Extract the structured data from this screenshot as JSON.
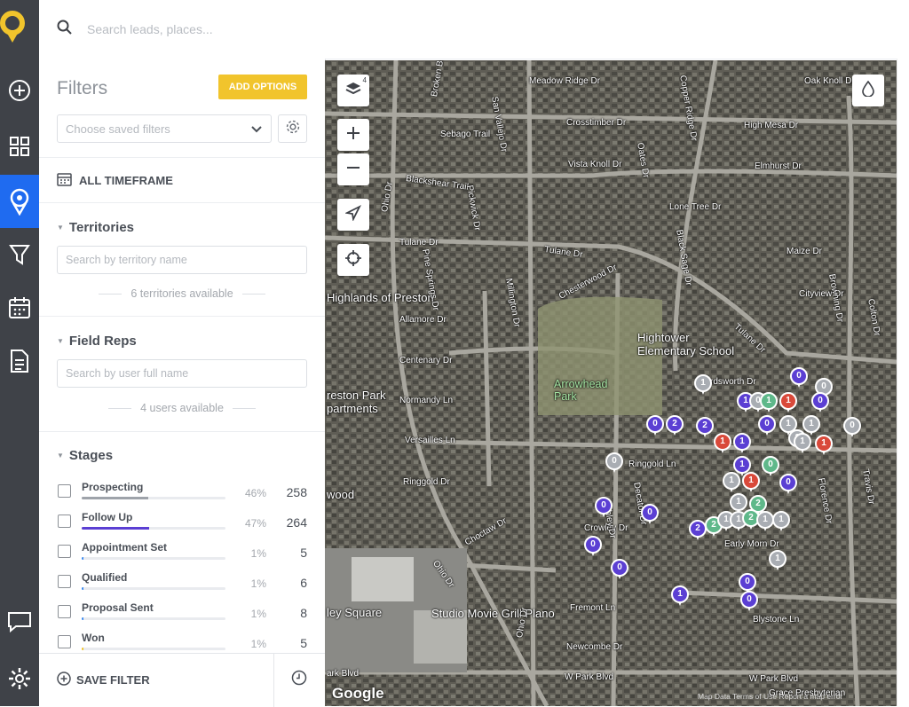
{
  "app": {
    "logo_icon": "map-pin-logo-icon",
    "accent": "#f1c42c",
    "active_nav": "#1f6bf0"
  },
  "nav": [
    "add-icon",
    "dashboard-grid-icon",
    "map-pin-icon",
    "funnel-icon",
    "calendar-icon",
    "document-icon",
    "chat-icon",
    "settings-icon"
  ],
  "search": {
    "placeholder": "Search leads, places..."
  },
  "filters": {
    "title": "Filters",
    "add_options": "ADD OPTIONS",
    "saved_placeholder": "Choose saved filters",
    "timeframe": "ALL TIMEFRAME",
    "territories": {
      "title": "Territories",
      "placeholder": "Search by territory name",
      "available": "6 territories available"
    },
    "field_reps": {
      "title": "Field Reps",
      "placeholder": "Search by user full name",
      "available": "4 users available"
    },
    "stages": {
      "title": "Stages",
      "items": [
        {
          "name": "Prospecting",
          "pct": "46%",
          "count": "258",
          "fill": 0.46,
          "color": "#9ea3aa"
        },
        {
          "name": "Follow Up",
          "pct": "47%",
          "count": "264",
          "fill": 0.47,
          "color": "#5b3fd3"
        },
        {
          "name": "Appointment Set",
          "pct": "1%",
          "count": "5",
          "fill": 0.01,
          "color": "#3f8cf0"
        },
        {
          "name": "Qualified",
          "pct": "1%",
          "count": "6",
          "fill": 0.01,
          "color": "#3f8cf0"
        },
        {
          "name": "Proposal Sent",
          "pct": "1%",
          "count": "8",
          "fill": 0.01,
          "color": "#3f8cf0"
        },
        {
          "name": "Won",
          "pct": "1%",
          "count": "5",
          "fill": 0.01,
          "color": "#f1c42c"
        }
      ]
    },
    "save_filter": "SAVE FILTER"
  },
  "map": {
    "layers_badge": "4",
    "labels": {
      "meadow_ridge": "Meadow Ridge Dr",
      "oak_knoll": "Oak Knoll Dr",
      "broken_bow": "Broken Bow Dr",
      "sebago": "Sebago Trail",
      "crosstimber": "Crosstimber Dr",
      "high_mesa": "High Mesa Dr",
      "vista_knoll": "Vista Knoll Dr",
      "elmhurst": "Elmhurst Dr",
      "blackshear": "Blackshear Trail",
      "ohio_top": "Ohio Dr",
      "lone_tree": "Lone Tree Dr",
      "tulane_w": "Tulane Dr",
      "tulane_e": "Tulane Dr",
      "maize": "Maize Dr",
      "highlands": "Highlands of Preston",
      "cityview": "Cityview Dr",
      "allamore": "Allamore Dr",
      "chesterwood": "Chesterwood Dr",
      "hightower": "Hightower\nElementary School",
      "tulane_diag": "Tulane Dr",
      "centenary": "Centenary Dr",
      "preston_park": "reston Park\npartments",
      "arrowhead": "Arrowhead\nPark",
      "normandy": "Normandy Ln",
      "hardsworth": "rdsworth Dr",
      "versailles": "Versailles Ln",
      "ringgold_w": "Ringgold Dr",
      "ringgold_e": "Ringgold Ln",
      "wood": "wood",
      "choctaw": "Choctaw Dr",
      "crowley": "Crowley Dr",
      "early_morn": "Early Morn Dr",
      "ohio_mid": "Ohio Dr",
      "fremont": "Fremont Ln",
      "ley_square": "ley Square",
      "studio": "Studio Movie Grill Plano",
      "blystone": "Blystone Ln",
      "newcombe": "Newcombe Dr",
      "ohio_bot": "Ohio Dr",
      "park_blvd_w": "ark Blvd",
      "park_blvd_mid": "W Park Blvd",
      "park_blvd_e": "W Park Blvd",
      "grace": "Grace Presbyterian",
      "pine_springs": "Pine Springs Dr",
      "pickwick": "Pickwick Dr",
      "millington": "Millington Dr",
      "san_vallejo": "San Vallejo Dr",
      "oates": "Oates Dr",
      "copper_ridge": "Copper Ridge Dr",
      "black_sage": "Black Sage Dr",
      "browning": "Browning Dr",
      "florence": "Florence Dr",
      "travis": "Travis Dr",
      "decator": "Decator Dr",
      "ashley": "Ashley Dr",
      "colton": "Colton Dr"
    },
    "google": "Google",
    "attribution": "Map Data   Terms of Use   Report a map error",
    "pin_colors": {
      "purple": "#5b3fd3",
      "gray": "#a9adb3",
      "red": "#d9493a",
      "green": "#5fb88a"
    },
    "pins": [
      {
        "c": "purple",
        "t": "0"
      },
      {
        "c": "gray",
        "t": "0"
      },
      {
        "c": "gray",
        "t": "1"
      },
      {
        "c": "purple",
        "t": "1"
      },
      {
        "c": "gray",
        "t": "0"
      },
      {
        "c": "green",
        "t": "1"
      },
      {
        "c": "purple",
        "t": "0"
      },
      {
        "c": "red",
        "t": "1"
      },
      {
        "c": "purple",
        "t": "0"
      },
      {
        "c": "purple",
        "t": "2"
      },
      {
        "c": "purple",
        "t": "2"
      },
      {
        "c": "purple",
        "t": "0"
      },
      {
        "c": "gray",
        "t": "1"
      },
      {
        "c": "gray",
        "t": "1"
      },
      {
        "c": "gray",
        "t": "1"
      },
      {
        "c": "red",
        "t": "1"
      },
      {
        "c": "gray",
        "t": "0"
      },
      {
        "c": "red",
        "t": "1"
      },
      {
        "c": "purple",
        "t": "1"
      },
      {
        "c": "gray",
        "t": "1"
      },
      {
        "c": "gray",
        "t": "0"
      },
      {
        "c": "purple",
        "t": "1"
      },
      {
        "c": "green",
        "t": "0"
      },
      {
        "c": "gray",
        "t": "1"
      },
      {
        "c": "red",
        "t": "1"
      },
      {
        "c": "purple",
        "t": "0"
      },
      {
        "c": "gray",
        "t": "1"
      },
      {
        "c": "green",
        "t": "2"
      },
      {
        "c": "purple",
        "t": "0"
      },
      {
        "c": "purple",
        "t": "0"
      },
      {
        "c": "purple",
        "t": "2"
      },
      {
        "c": "green",
        "t": "2"
      },
      {
        "c": "gray",
        "t": "1"
      },
      {
        "c": "gray",
        "t": "1"
      },
      {
        "c": "green",
        "t": "2"
      },
      {
        "c": "gray",
        "t": "1"
      },
      {
        "c": "gray",
        "t": "1"
      },
      {
        "c": "purple",
        "t": "0"
      },
      {
        "c": "gray",
        "t": "1"
      },
      {
        "c": "purple",
        "t": "0"
      },
      {
        "c": "purple",
        "t": "0"
      },
      {
        "c": "purple",
        "t": "1"
      },
      {
        "c": "purple",
        "t": "0"
      }
    ]
  }
}
